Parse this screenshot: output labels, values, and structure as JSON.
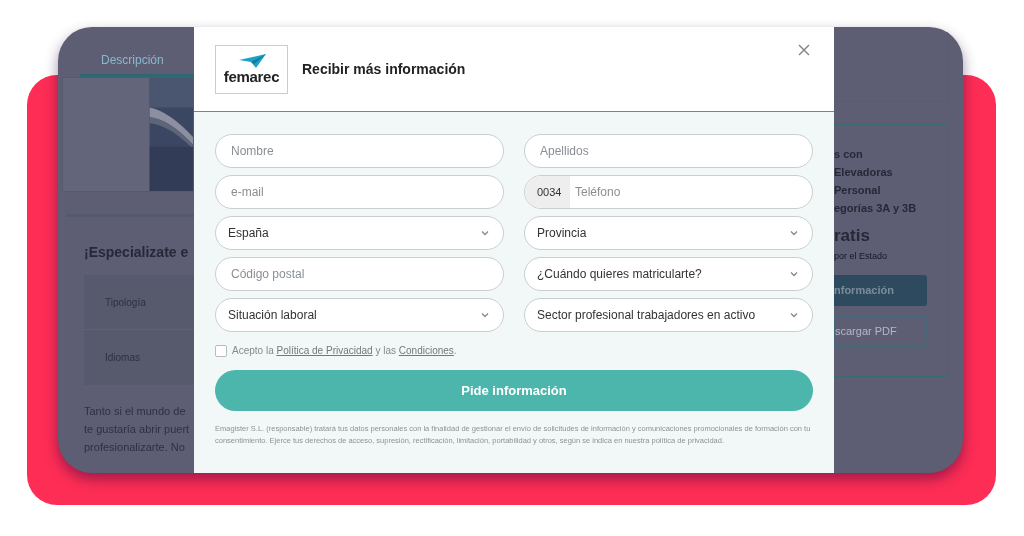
{
  "background_page": {
    "tab": {
      "label": "Descripción",
      "selected": true
    },
    "heading": "¡Especializate e",
    "table_rows": [
      {
        "label": "Tipología"
      },
      {
        "label": "Idiomas"
      }
    ],
    "paragraph_lines": [
      "Tanto si el mundo de",
      "te gustaría abrir puert",
      "profesionalizarte. No"
    ],
    "side_card": {
      "lines": [
        "s con",
        "Elevadoras",
        "Personal",
        "egorías 3A y 3B"
      ],
      "price": "ratis",
      "price_note": "por el Estado",
      "buttons": [
        {
          "label": "nformación",
          "kind": "primary"
        },
        {
          "label": "scargar PDF",
          "kind": "outline"
        }
      ]
    }
  },
  "modal": {
    "logo": "femarec",
    "title": "Recibir más información",
    "fields": [
      {
        "kind": "text",
        "placeholder": "Nombre"
      },
      {
        "kind": "text",
        "placeholder": "Apellidos"
      },
      {
        "kind": "text",
        "placeholder": "e-mail"
      },
      {
        "kind": "phone",
        "prefix": "0034",
        "placeholder": "Teléfono"
      },
      {
        "kind": "select",
        "value": "España"
      },
      {
        "kind": "select",
        "value": "Provincia"
      },
      {
        "kind": "text",
        "placeholder": "Código postal"
      },
      {
        "kind": "select",
        "value": "¿Cuándo quieres matricularte?"
      },
      {
        "kind": "select",
        "value": "Situación laboral"
      },
      {
        "kind": "select",
        "value": "Sector profesional trabajadores en activo"
      }
    ],
    "consent": {
      "checked": false,
      "parts": [
        {
          "kind": "text",
          "text": "Acepto la "
        },
        {
          "kind": "link",
          "text": "Política de Privacidad"
        },
        {
          "kind": "text",
          "text": " y las "
        },
        {
          "kind": "link",
          "text": "Condiciones"
        },
        {
          "kind": "text",
          "text": "."
        }
      ]
    },
    "submit": "Pide información",
    "disclaimer": "Emagister S.L. (responsable) tratará tus datos personales con la finalidad de gestionar el envío de solicitudes de información y comunicaciones promocionales de formación con tu consentimiento. Ejerce tus derechos de acceso, supresión, rectificación, limitación, portabilidad y otros, según se indica en nuestra política de privacidad."
  }
}
